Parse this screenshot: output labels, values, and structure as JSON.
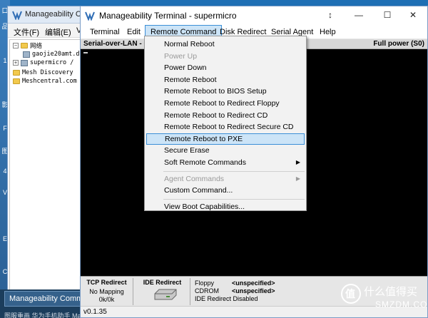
{
  "desktop": {
    "glyphs": [
      "口",
      "品",
      "1",
      "影",
      "F",
      "图",
      "4",
      "V",
      "E",
      "C"
    ]
  },
  "bg_window": {
    "title": "Manageability Comm",
    "menus": [
      "文件(F)",
      "编辑(E)",
      "V"
    ],
    "tree": [
      {
        "label": "网络",
        "kind": "folder",
        "expander": "−"
      },
      {
        "label": "gaojie20amt.d",
        "kind": "pc",
        "expander": ""
      },
      {
        "label": "supermicro /",
        "kind": "pc",
        "expander": "+"
      },
      {
        "label": "Mesh Discovery",
        "kind": "folder",
        "expander": ""
      },
      {
        "label": "Meshcentral.com",
        "kind": "folder",
        "expander": ""
      }
    ]
  },
  "taskbar": {
    "item_label": "Manageability Comman",
    "bottom_text": "图服重画   华为手机助手   Manageability Terminal   超微主机..."
  },
  "watermark": {
    "text": "什么值得买",
    "sub": "SMZDM.COM",
    "logo": "值"
  },
  "main_window": {
    "title": "Manageability Terminal - supermicro",
    "controls": {
      "pin": "↕",
      "minimize": "—",
      "maximize": "☐",
      "close": "✕"
    },
    "menus": [
      "Terminal",
      "Edit",
      "Remote Command",
      "Disk Redirect",
      "Serial Agent",
      "Help"
    ],
    "active_menu": "Remote Command",
    "status": {
      "sol_label": "Serial-over-LAN - Co",
      "power": "Full power (S0)"
    },
    "bottom": {
      "tcp_title": "TCP Redirect",
      "tcp_mapping": "No Mapping",
      "tcp_traffic": "0k/0k",
      "ide_title": "IDE Redirect",
      "devices": [
        {
          "label": "Floppy",
          "value": "<unspecified>"
        },
        {
          "label": "CDROM",
          "value": "<unspecified>"
        }
      ],
      "ide_status": "IDE Redirect Disabled"
    },
    "version": "v0.1.35"
  },
  "dropdown": {
    "items": [
      {
        "label": "Normal Reboot",
        "state": "normal"
      },
      {
        "label": "Power Up",
        "state": "disabled"
      },
      {
        "label": "Power Down",
        "state": "normal"
      },
      {
        "label": "Remote Reboot",
        "state": "normal"
      },
      {
        "label": "Remote Reboot to BIOS Setup",
        "state": "normal"
      },
      {
        "label": "Remote Reboot to Redirect Floppy",
        "state": "normal"
      },
      {
        "label": "Remote Reboot to Redirect CD",
        "state": "normal"
      },
      {
        "label": "Remote Reboot to Redirect Secure CD",
        "state": "normal"
      },
      {
        "label": "Remote Reboot to PXE",
        "state": "highlight"
      },
      {
        "label": "Secure Erase",
        "state": "normal"
      },
      {
        "label": "Soft Remote Commands",
        "state": "submenu"
      },
      {
        "separator": true
      },
      {
        "label": "Agent Commands",
        "state": "disabled-submenu"
      },
      {
        "label": "Custom Command...",
        "state": "normal"
      },
      {
        "separator": true
      },
      {
        "label": "View Boot Capabilities...",
        "state": "normal"
      }
    ],
    "submenu_arrow": "▶"
  },
  "colors": {
    "highlight": "#cce4f7",
    "highlight_border": "#3c8fd7",
    "terminal_bg": "#000000",
    "desktop": "#1e6fb4"
  }
}
